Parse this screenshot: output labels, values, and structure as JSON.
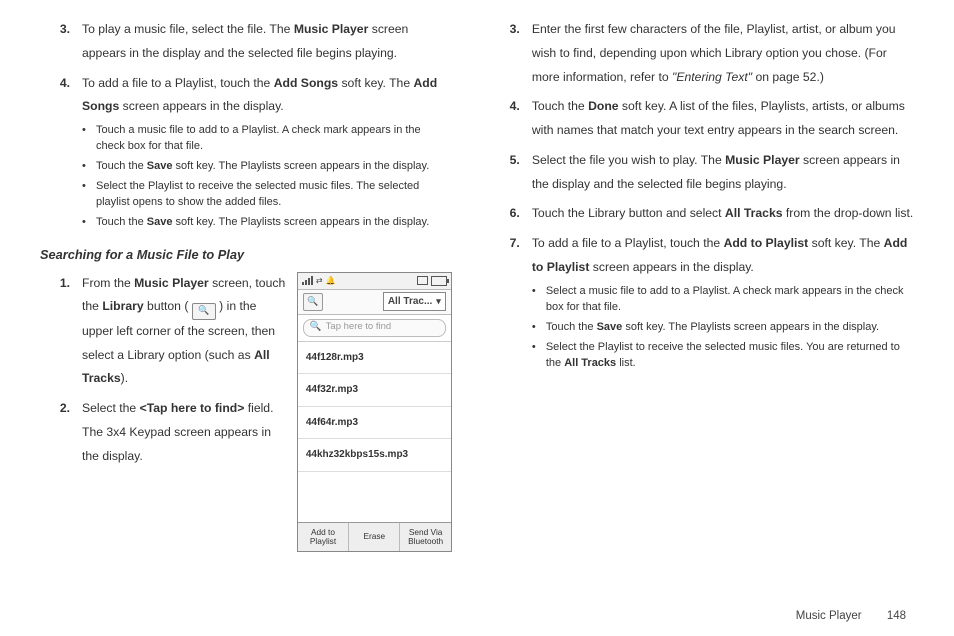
{
  "left": {
    "step3": {
      "num": "3.",
      "pre": "To play a music file, select the file. The ",
      "b1": "Music Player",
      "post": " screen appears in the display and the selected file begins playing."
    },
    "step4": {
      "num": "4.",
      "pre": "To add a file to a Playlist, touch the ",
      "b1": "Add Songs",
      "mid": " soft key. The ",
      "b2": "Add Songs",
      "post": " screen appears in the display."
    },
    "bullets4": {
      "a": "Touch a music file to add to a Playlist. A check mark appears in the check box for that file.",
      "b_pre": "Touch the ",
      "b_b": "Save",
      "b_post": " soft key. The Playlists screen appears in the display.",
      "c": "Select the Playlist to receive the selected music files. The selected playlist opens to show the added files.",
      "d_pre": "Touch the ",
      "d_b": "Save",
      "d_post": " soft key. The Playlists screen appears in the display."
    },
    "section_title": "Searching for a Music File to Play",
    "step1": {
      "num": "1.",
      "pre": "From the ",
      "b1": "Music Player",
      "mid1": " screen, touch the ",
      "b2": "Library",
      "mid2": " button ( ",
      "mid3": " ) in the upper left corner of the screen, then select a Library option (such as ",
      "b3": "All Tracks",
      "post": ")."
    },
    "step2": {
      "num": "2.",
      "pre": "Select the ",
      "b1": "<Tap here to find>",
      "post": " field. The 3x4 Keypad screen appears in the display."
    }
  },
  "phone": {
    "dropdown": "All Trac...",
    "search_placeholder": "Tap here to find",
    "files": [
      "44f128r.mp3",
      "44f32r.mp3",
      "44f64r.mp3",
      "44khz32kbps15s.mp3"
    ],
    "softkeys": {
      "a": "Add to\nPlaylist",
      "b": "Erase",
      "c": "Send Via\nBluetooth"
    }
  },
  "right": {
    "step3": {
      "num": "3.",
      "pre": "Enter the first few characters of the file, Playlist, artist, or album you wish to find, depending upon which Library option you chose. (For more information, refer to ",
      "i1": "\"Entering Text\"",
      "post": "  on page 52.)"
    },
    "step4": {
      "num": "4.",
      "pre": "Touch the ",
      "b1": "Done",
      "post": " soft key. A list of the files, Playlists, artists, or albums with names that match your text entry appears in the search screen."
    },
    "step5": {
      "num": "5.",
      "pre": "Select the file you wish to play. The ",
      "b1": "Music Player",
      "post": " screen appears in the display and the selected file begins playing."
    },
    "step6": {
      "num": "6.",
      "pre": "Touch the Library button and select ",
      "b1": "All Tracks",
      "post": " from the drop-down list."
    },
    "step7": {
      "num": "7.",
      "pre": "To add a file to a Playlist, touch the ",
      "b1": "Add to Playlist",
      "mid": " soft key. The ",
      "b2": "Add to Playlist",
      "post": " screen appears in the display."
    },
    "bullets7": {
      "a": "Select a music file to add to a Playlist. A check mark appears in the check box for that file.",
      "b_pre": "Touch the ",
      "b_b": "Save",
      "b_post": " soft key. The Playlists screen appears in the display.",
      "c_pre": "Select the Playlist to receive the selected music files. You are returned to the ",
      "c_b": "All Tracks",
      "c_post": " list."
    }
  },
  "footer": {
    "section": "Music Player",
    "page": "148"
  }
}
